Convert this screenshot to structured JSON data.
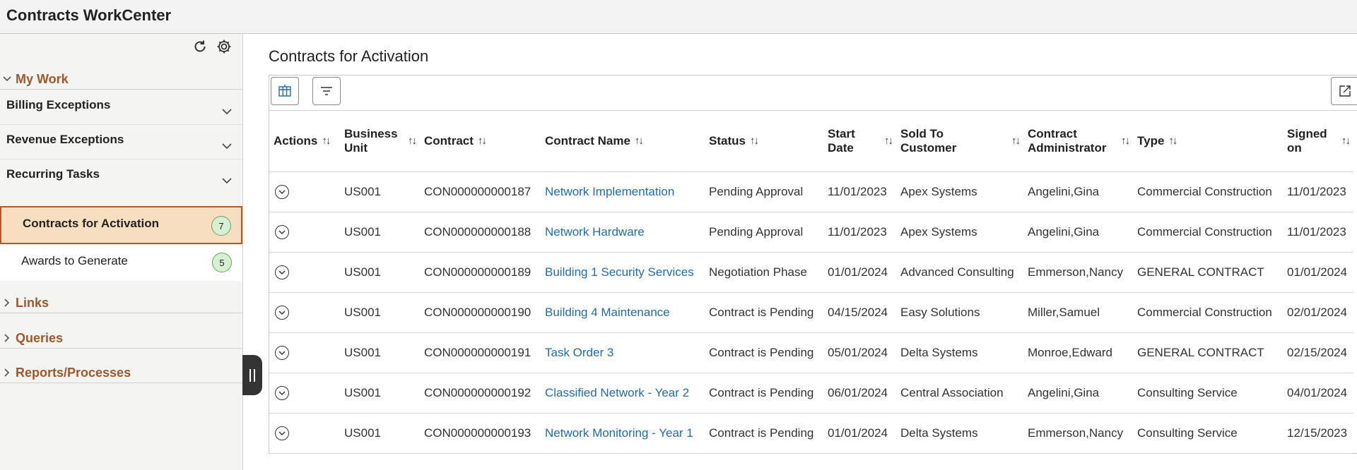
{
  "app": {
    "title": "Contracts WorkCenter"
  },
  "sidebar": {
    "tools": {
      "refresh_icon": "refresh-icon",
      "settings_icon": "gear-icon"
    },
    "my_work": {
      "label": "My Work"
    },
    "sections": [
      {
        "label": "Billing Exceptions"
      },
      {
        "label": "Revenue Exceptions"
      },
      {
        "label": "Recurring Tasks"
      }
    ],
    "items": [
      {
        "label": "Contracts for Activation",
        "count": "7",
        "active": true
      },
      {
        "label": "Awards to Generate",
        "count": "5",
        "active": false
      }
    ],
    "groups": [
      {
        "label": "Links"
      },
      {
        "label": "Queries"
      },
      {
        "label": "Reports/Processes"
      }
    ]
  },
  "main": {
    "title": "Contracts for Activation",
    "toolbar": {
      "columns_icon": "columns-icon",
      "filter_icon": "filter-icon",
      "export_icon": "export-icon"
    },
    "columns": [
      "Actions",
      "Business Unit",
      "Contract",
      "Contract Name",
      "Status",
      "Start Date",
      "Sold To Customer",
      "Contract Administrator",
      "Type",
      "Signed on"
    ],
    "rows": [
      {
        "business_unit": "US001",
        "contract": "CON000000000187",
        "name": "Network Implementation",
        "status": "Pending Approval",
        "start_date": "11/01/2023",
        "customer": "Apex Systems",
        "administrator": "Angelini,Gina",
        "type": "Commercial Construction",
        "signed_on": "11/01/2023"
      },
      {
        "business_unit": "US001",
        "contract": "CON000000000188",
        "name": "Network Hardware",
        "status": "Pending Approval",
        "start_date": "11/01/2023",
        "customer": "Apex Systems",
        "administrator": "Angelini,Gina",
        "type": "Commercial Construction",
        "signed_on": "11/01/2023"
      },
      {
        "business_unit": "US001",
        "contract": "CON000000000189",
        "name": "Building 1 Security Services",
        "status": "Negotiation Phase",
        "start_date": "01/01/2024",
        "customer": "Advanced Consulting",
        "administrator": "Emmerson,Nancy",
        "type": "GENERAL CONTRACT",
        "signed_on": "01/01/2024"
      },
      {
        "business_unit": "US001",
        "contract": "CON000000000190",
        "name": "Building 4 Maintenance",
        "status": "Contract is Pending",
        "start_date": "04/15/2024",
        "customer": "Easy Solutions",
        "administrator": "Miller,Samuel",
        "type": "Commercial Construction",
        "signed_on": "02/01/2024"
      },
      {
        "business_unit": "US001",
        "contract": "CON000000000191",
        "name": "Task Order 3",
        "status": "Contract is Pending",
        "start_date": "05/01/2024",
        "customer": "Delta Systems",
        "administrator": "Monroe,Edward",
        "type": "GENERAL CONTRACT",
        "signed_on": "02/15/2024"
      },
      {
        "business_unit": "US001",
        "contract": "CON000000000192",
        "name": "Classified Network - Year 2",
        "status": "Contract is Pending",
        "start_date": "06/01/2024",
        "customer": "Central Association",
        "administrator": "Angelini,Gina",
        "type": "Consulting Service",
        "signed_on": "04/01/2024"
      },
      {
        "business_unit": "US001",
        "contract": "CON000000000193",
        "name": "Network Monitoring - Year 1",
        "status": "Contract is Pending",
        "start_date": "01/01/2024",
        "customer": "Delta Systems",
        "administrator": "Emmerson,Nancy",
        "type": "Consulting Service",
        "signed_on": "12/15/2023"
      }
    ]
  },
  "colors": {
    "accent": "#a0572b",
    "link": "#1f6cb0",
    "active_bg": "#f7dec0",
    "badge_bg": "#d8f0d2"
  }
}
